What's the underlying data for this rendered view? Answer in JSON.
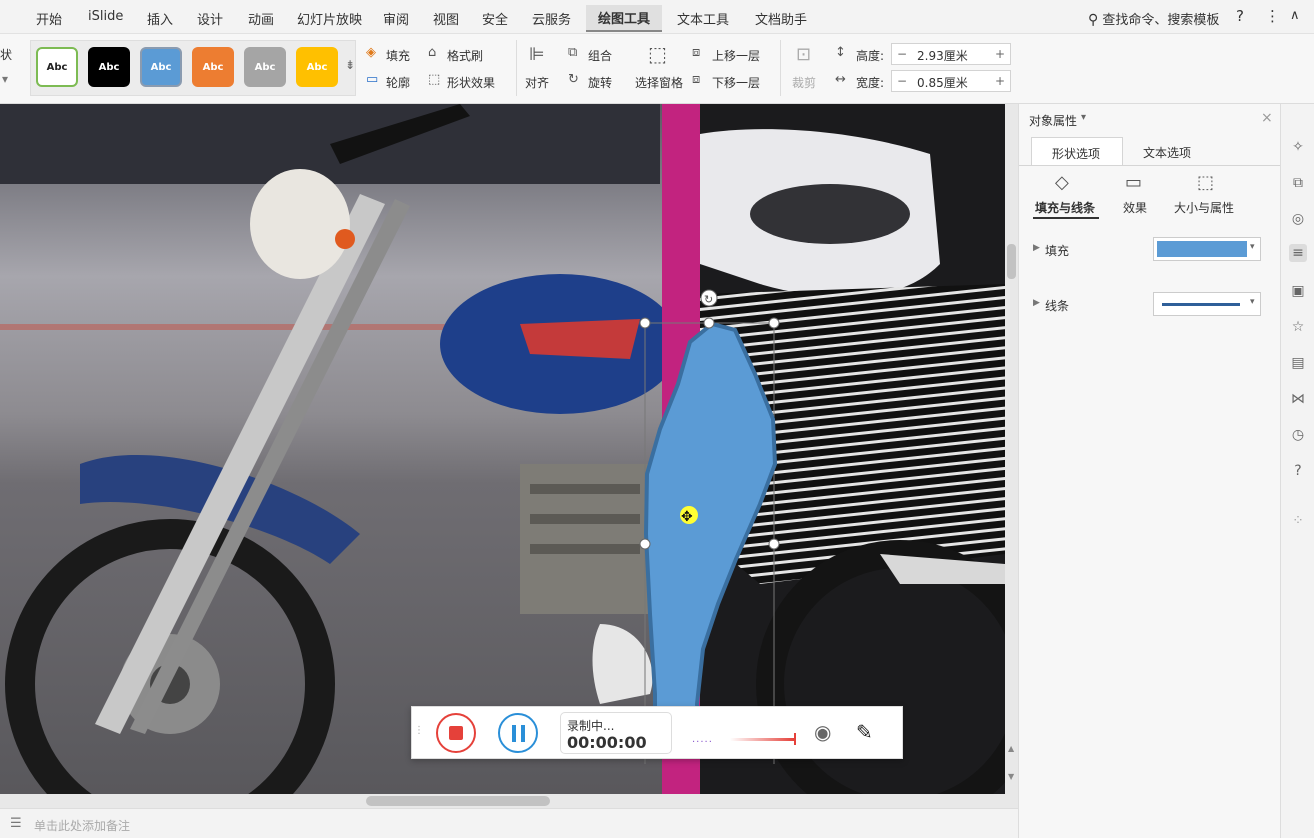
{
  "menubar": {
    "items": [
      "开始",
      "iSlide",
      "插入",
      "设计",
      "动画",
      "幻灯片放映",
      "审阅",
      "视图",
      "安全",
      "云服务",
      "绘图工具",
      "文本工具",
      "文档助手"
    ],
    "active": "绘图工具",
    "search": "查找命令、搜索模板",
    "help": "?",
    "more": "⋮"
  },
  "ribbon": {
    "style_label": "Abc",
    "fill": "填充",
    "format_painter": "格式刷",
    "outline": "轮廓",
    "shape_effects": "形状效果",
    "align": "对齐",
    "group": "组合",
    "rotate": "旋转",
    "selection_pane": "选择窗格",
    "bring_forward": "上移一层",
    "send_backward": "下移一层",
    "crop": "裁剪",
    "height_label": "高度:",
    "height_value": "2.93厘米",
    "width_label": "宽度:",
    "width_value": "0.85厘米",
    "left_trunc": "状"
  },
  "panel": {
    "title": "对象属性",
    "tabs": [
      "形状选项",
      "文本选项"
    ],
    "subtabs": [
      "填充与线条",
      "效果",
      "大小与属性"
    ],
    "fill_label": "填充",
    "line_label": "线条"
  },
  "recorder": {
    "status": "录制中...",
    "time": "00:00:00"
  },
  "notes": {
    "placeholder": "单击此处添加备注"
  },
  "colors": {
    "shape_fill": "#5b9bd5",
    "shape_stroke": "#3a6fa0",
    "magenta_bar": "#c2237f",
    "record_red": "#e5413a",
    "pause_blue": "#2a8fd8"
  }
}
